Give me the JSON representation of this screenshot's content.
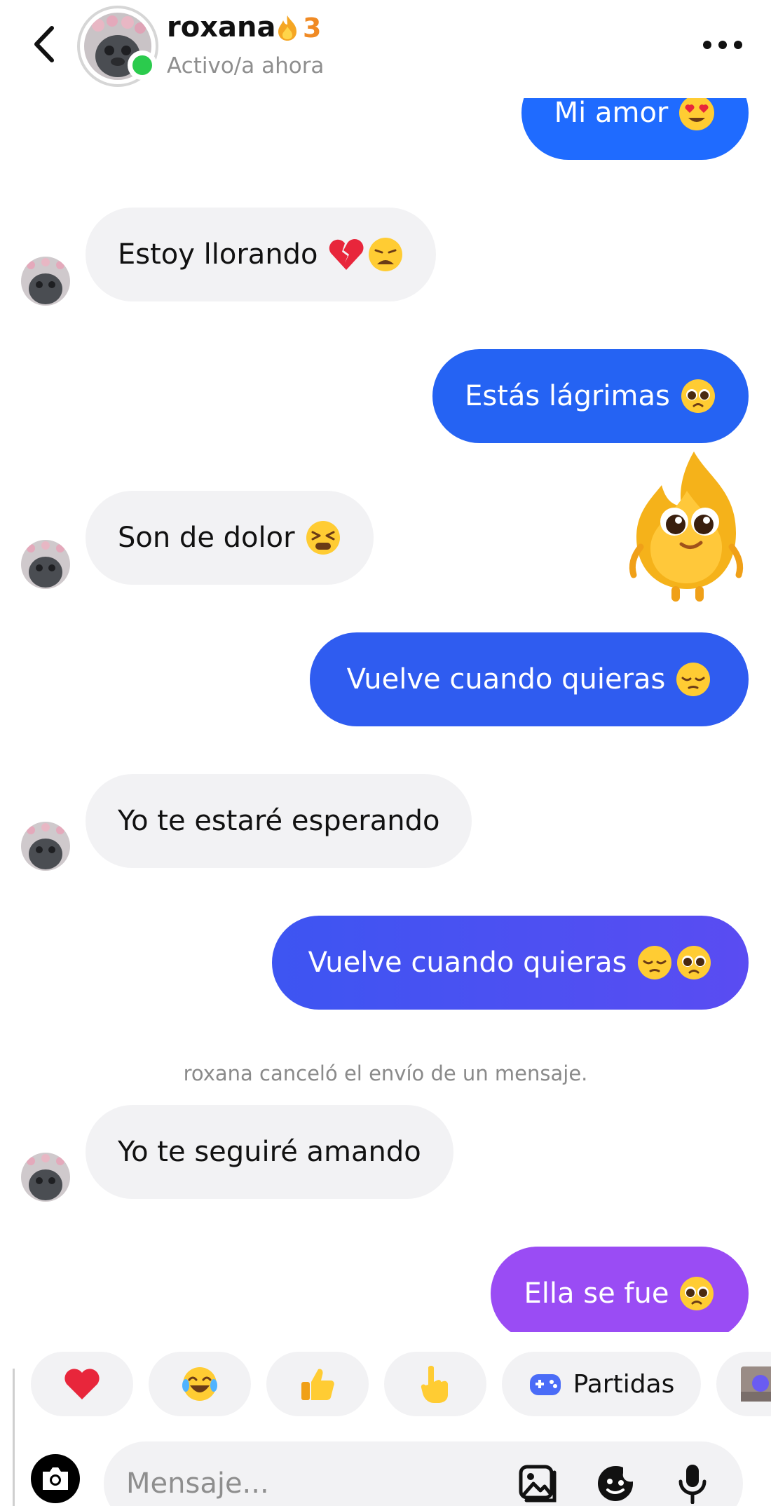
{
  "header": {
    "name": "roxana",
    "streak_count": "3",
    "status": "Activo/a ahora",
    "online_color": "#2bcb4d"
  },
  "messages": [
    {
      "direction": "out",
      "text": "Mi amor",
      "emoji": [
        "smiling-face-with-heart-eyes"
      ]
    },
    {
      "direction": "in",
      "text": "Estoy llorando",
      "emoji": [
        "broken-heart",
        "weary-face"
      ]
    },
    {
      "direction": "out",
      "text": "Estás lágrimas",
      "emoji": [
        "pleading-face"
      ]
    },
    {
      "direction": "in",
      "text": "Son de dolor",
      "emoji": [
        "tired-face"
      ]
    },
    {
      "direction": "out",
      "text": "Vuelve cuando quieras",
      "emoji": [
        "pensive-face"
      ]
    },
    {
      "direction": "in",
      "text": "Yo te estaré esperando",
      "emoji": []
    },
    {
      "direction": "out",
      "text": "Vuelve cuando quieras",
      "emoji": [
        "pensive-face",
        "pleading-face"
      ]
    },
    {
      "direction": "in",
      "text": "Yo te seguiré amando",
      "emoji": []
    },
    {
      "direction": "out",
      "text": "Ella se fue",
      "emoji": [
        "pleading-face"
      ]
    }
  ],
  "system_note": "roxana canceló el envío de un mensaje.",
  "sticker": {
    "name": "flame-character-sticker"
  },
  "quick_reactions": [
    {
      "icon": "heart-icon"
    },
    {
      "icon": "tears-of-joy-icon"
    },
    {
      "icon": "thumbs-up-icon"
    },
    {
      "icon": "pointing-hand-icon"
    },
    {
      "icon": "gamepad-icon",
      "label": "Partidas"
    },
    {
      "icon": "photo-thumbnail-icon"
    }
  ],
  "composer": {
    "placeholder": "Mensaje...",
    "icons": [
      "camera-icon",
      "gallery-icon",
      "sticker-icon",
      "microphone-icon"
    ]
  },
  "colors": {
    "bubble_in": "#f2f2f4",
    "bubble_out_blue": "#1f6bff",
    "bubble_out_indigo": "#3d55f2",
    "bubble_out_purple": "#9a4cf4",
    "streak_orange": "#f08a24"
  }
}
